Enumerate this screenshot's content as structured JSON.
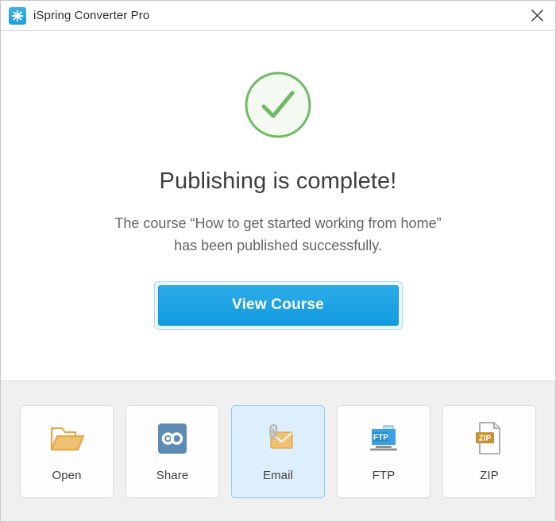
{
  "titlebar": {
    "app_name": "iSpring Converter Pro",
    "app_icon": "ispring-star-icon",
    "close_icon": "close-icon",
    "close_label": "✕"
  },
  "main": {
    "status_icon": "check-circle-icon",
    "headline": "Publishing is complete!",
    "description": "The course “How to get started working from home” has been published successfully.",
    "primary_button": "View Course"
  },
  "footer": {
    "actions": [
      {
        "label": "Open",
        "icon": "open-folder-icon",
        "selected": false
      },
      {
        "label": "Share",
        "icon": "share-link-icon",
        "selected": false
      },
      {
        "label": "Email",
        "icon": "email-attachment-icon",
        "selected": true
      },
      {
        "label": "FTP",
        "icon": "ftp-server-icon",
        "selected": false
      },
      {
        "label": "ZIP",
        "icon": "zip-file-icon",
        "selected": false
      }
    ]
  },
  "colors": {
    "accent_blue": "#1c9fe0",
    "success_green": "#72b967",
    "selected_tile_bg": "#ddeffc",
    "selected_tile_border": "#8ccdf0",
    "footer_bg": "#f0f0f0",
    "folder_orange": "#e3a84a",
    "share_blue": "#5d8bb3",
    "zip_gold": "#c79434"
  }
}
